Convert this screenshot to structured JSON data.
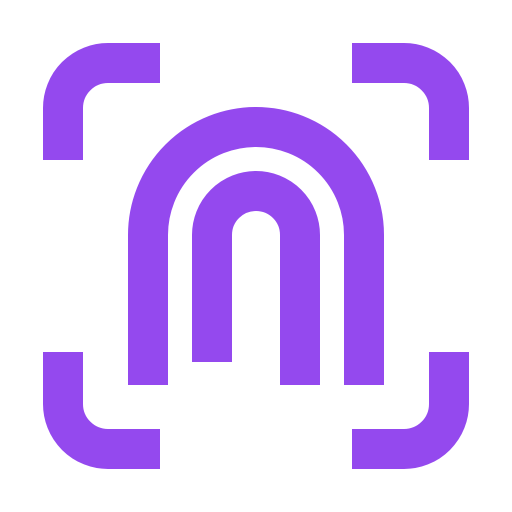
{
  "icon": {
    "name": "fingerprint-scan-icon",
    "color": "#9449EE",
    "background": "#FFFFFF"
  }
}
